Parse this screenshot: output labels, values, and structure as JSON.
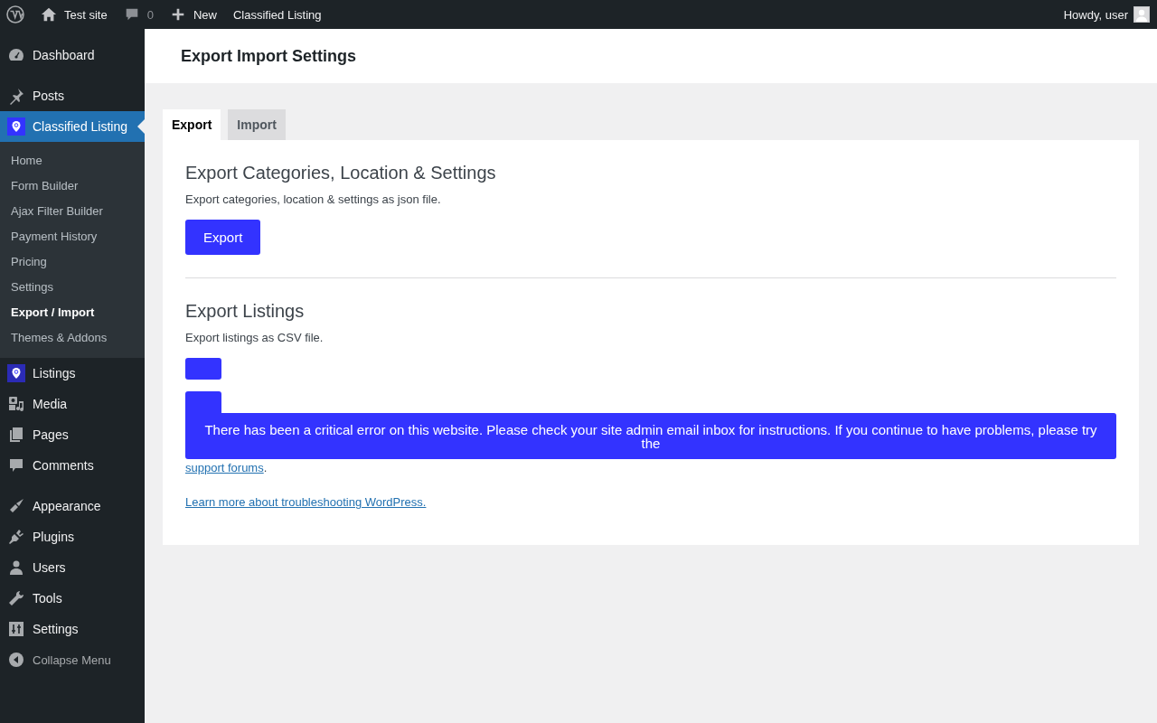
{
  "admin_bar": {
    "site": "Test site",
    "comments": "0",
    "new": "New",
    "plugin": "Classified Listing",
    "greeting": "Howdy, user"
  },
  "sidebar": {
    "groups": [
      {
        "items": [
          {
            "label": "Dashboard",
            "kind": "dashboard",
            "selected": false
          }
        ]
      },
      {
        "items": [
          {
            "label": "Posts",
            "kind": "pin",
            "selected": false
          },
          {
            "label": "Classified Listing",
            "kind": "listing",
            "selected": true,
            "children": [
              {
                "label": "Home",
                "selected": false
              },
              {
                "label": "Form Builder",
                "selected": false
              },
              {
                "label": "Ajax Filter Builder",
                "selected": false
              },
              {
                "label": "Payment History",
                "selected": false
              },
              {
                "label": "Pricing",
                "selected": false
              },
              {
                "label": "Settings",
                "selected": false
              },
              {
                "label": "Export / Import",
                "selected": true
              },
              {
                "label": "Themes & Addons",
                "selected": false
              }
            ]
          },
          {
            "label": "Listings",
            "kind": "listing",
            "selected": false
          },
          {
            "label": "Media",
            "kind": "media",
            "selected": false
          },
          {
            "label": "Pages",
            "kind": "pages",
            "selected": false
          },
          {
            "label": "Comments",
            "kind": "comment",
            "selected": false
          }
        ]
      },
      {
        "items": [
          {
            "label": "Appearance",
            "kind": "brush",
            "selected": false
          },
          {
            "label": "Plugins",
            "kind": "plug",
            "selected": false
          },
          {
            "label": "Users",
            "kind": "user",
            "selected": false
          },
          {
            "label": "Tools",
            "kind": "wrench",
            "selected": false
          },
          {
            "label": "Settings",
            "kind": "sliders",
            "selected": false
          }
        ]
      }
    ],
    "collapse": "Collapse Menu"
  },
  "page_title": "Export Import Settings",
  "tabs": [
    {
      "label": "Export",
      "selected": true
    },
    {
      "label": "Import",
      "selected": false
    }
  ],
  "sections": [
    {
      "title": "Export Categories, Location & Settings",
      "description": "Export categories, location & settings as json file.",
      "button": "Export"
    },
    {
      "title": "Export Listings",
      "description": "Export listings as CSV file."
    }
  ],
  "error": {
    "message": "There has been a critical error on this website. Please check your site admin email inbox for instructions. If you continue to have problems, please try the",
    "link": "support forums",
    "after_link": ".",
    "learn_more": "Learn more about troubleshooting WordPress."
  }
}
